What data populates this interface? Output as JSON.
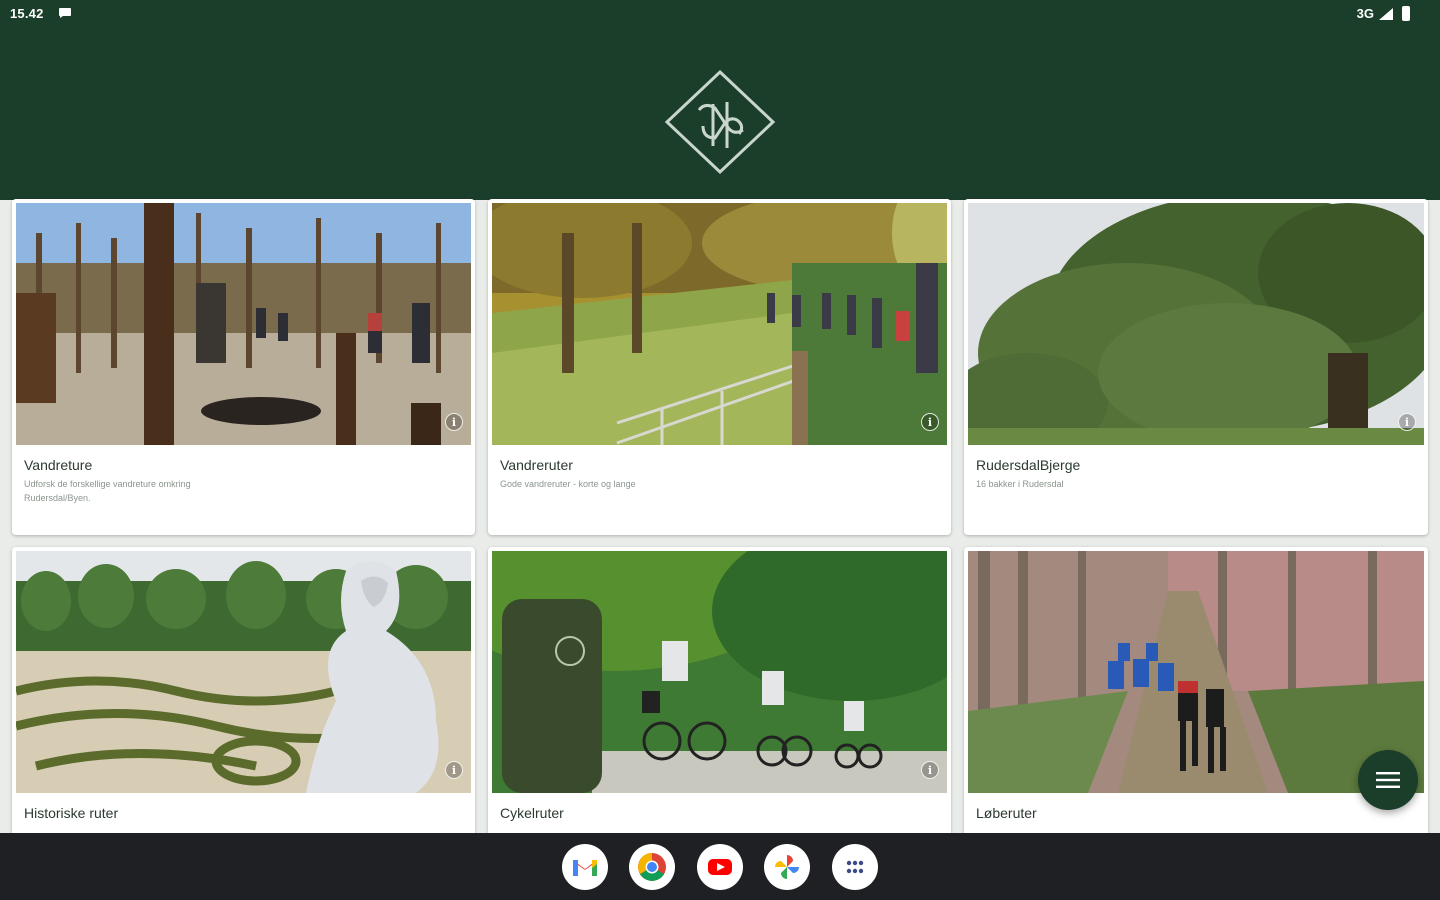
{
  "status_bar": {
    "time": "15.42",
    "network": "3G"
  },
  "header": {
    "logo_icon": "rudersdal-diamond-logo-icon"
  },
  "cards": [
    {
      "title": "Vandreture",
      "description": "Udforsk de forskellige vandreture omkring Rudersdal/Byen."
    },
    {
      "title": "Vandreruter",
      "description": "Gode vandreruter - korte og lange"
    },
    {
      "title": "RudersdalBjerge",
      "description": "16 bakker i Rudersdal"
    },
    {
      "title": "Historiske ruter",
      "description": ""
    },
    {
      "title": "Cykelruter",
      "description": ""
    },
    {
      "title": "Løberuter",
      "description": ""
    }
  ],
  "info_label": "i",
  "fab_icon": "menu-icon",
  "dock_apps": [
    "gmail-icon",
    "chrome-icon",
    "youtube-icon",
    "photos-icon",
    "app-drawer-icon"
  ],
  "colors": {
    "brand": "#1b3e2a",
    "dock": "#1e2023"
  }
}
